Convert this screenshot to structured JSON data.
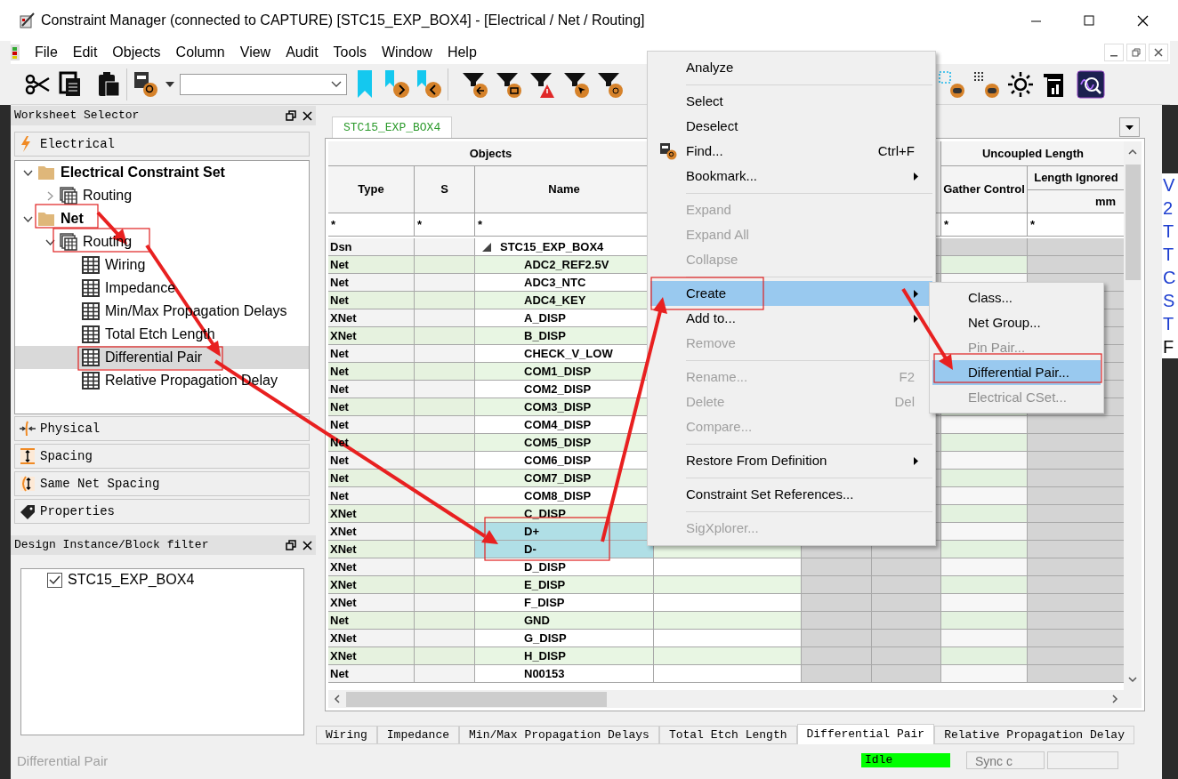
{
  "window": {
    "title": "Constraint Manager (connected to CAPTURE) [STC15_EXP_BOX4] - [Electrical / Net / Routing]"
  },
  "menu_bar": [
    "File",
    "Edit",
    "Objects",
    "Column",
    "View",
    "Audit",
    "Tools",
    "Window",
    "Help"
  ],
  "worksheet_selector": {
    "title": "Worksheet Selector",
    "active_domain": {
      "label": "Electrical",
      "kind": "electrical"
    },
    "tree": [
      {
        "label": "Electrical Constraint Set",
        "kind": "folder",
        "expanded": true,
        "selected": false,
        "children": [
          {
            "label": "Routing",
            "kind": "sheets",
            "expanded": false,
            "selected": false
          }
        ]
      },
      {
        "label": "Net",
        "kind": "folder",
        "expanded": true,
        "selected": false,
        "children": [
          {
            "label": "Routing",
            "kind": "sheets",
            "expanded": true,
            "selected": false,
            "children": [
              {
                "label": "Wiring",
                "kind": "sheet",
                "selected": false
              },
              {
                "label": "Impedance",
                "kind": "sheet",
                "selected": false
              },
              {
                "label": "Min/Max Propagation Delays",
                "kind": "sheet",
                "selected": false
              },
              {
                "label": "Total Etch Length",
                "kind": "sheet",
                "selected": false
              },
              {
                "label": "Differential Pair",
                "kind": "sheet",
                "selected": true
              },
              {
                "label": "Relative Propagation Delay",
                "kind": "sheet",
                "selected": false
              }
            ]
          }
        ]
      }
    ],
    "domains": [
      {
        "label": "Physical",
        "kind": "physical"
      },
      {
        "label": "Spacing",
        "kind": "spacing"
      },
      {
        "label": "Same Net Spacing",
        "kind": "same_net"
      },
      {
        "label": "Properties",
        "kind": "properties"
      }
    ]
  },
  "block_filter": {
    "title": "Design Instance/Block filter",
    "items": [
      {
        "label": "STC15_EXP_BOX4",
        "checked": true
      }
    ]
  },
  "worksheet": {
    "tab": "STC15_EXP_BOX4",
    "objects_header": "Objects",
    "columns": [
      "Type",
      "S",
      "Name"
    ],
    "uncoupled_header": "Uncoupled Length",
    "gather_header": "Gather Control",
    "length_header": "Length Ignored",
    "length_unit": "mm",
    "filters": [
      "*",
      "*",
      "*",
      "*",
      "*"
    ],
    "rows": [
      {
        "type": "Dsn",
        "name": "STC15_EXP_BOX4",
        "kind": "design",
        "selected": false
      },
      {
        "type": "Net",
        "name": "ADC2_REF2.5V",
        "kind": "net",
        "selected": false
      },
      {
        "type": "Net",
        "name": "ADC3_NTC",
        "kind": "net",
        "selected": false
      },
      {
        "type": "Net",
        "name": "ADC4_KEY",
        "kind": "net",
        "selected": false
      },
      {
        "type": "XNet",
        "name": "A_DISP",
        "kind": "net",
        "selected": false
      },
      {
        "type": "XNet",
        "name": "B_DISP",
        "kind": "net",
        "selected": false
      },
      {
        "type": "Net",
        "name": "CHECK_V_LOW",
        "kind": "net",
        "selected": false
      },
      {
        "type": "Net",
        "name": "COM1_DISP",
        "kind": "net",
        "selected": false
      },
      {
        "type": "Net",
        "name": "COM2_DISP",
        "kind": "net",
        "selected": false
      },
      {
        "type": "Net",
        "name": "COM3_DISP",
        "kind": "net",
        "selected": false
      },
      {
        "type": "Net",
        "name": "COM4_DISP",
        "kind": "net",
        "selected": false
      },
      {
        "type": "Net",
        "name": "COM5_DISP",
        "kind": "net",
        "selected": false
      },
      {
        "type": "Net",
        "name": "COM6_DISP",
        "kind": "net",
        "selected": false
      },
      {
        "type": "Net",
        "name": "COM7_DISP",
        "kind": "net",
        "selected": false
      },
      {
        "type": "Net",
        "name": "COM8_DISP",
        "kind": "net",
        "selected": false
      },
      {
        "type": "XNet",
        "name": "C_DISP",
        "kind": "net",
        "selected": false
      },
      {
        "type": "XNet",
        "name": "D+",
        "kind": "net",
        "selected": true
      },
      {
        "type": "XNet",
        "name": "D-",
        "kind": "net",
        "selected": true
      },
      {
        "type": "XNet",
        "name": "D_DISP",
        "kind": "net",
        "selected": false
      },
      {
        "type": "XNet",
        "name": "E_DISP",
        "kind": "net",
        "selected": false
      },
      {
        "type": "XNet",
        "name": "F_DISP",
        "kind": "net",
        "selected": false
      },
      {
        "type": "Net",
        "name": "GND",
        "kind": "net",
        "selected": false
      },
      {
        "type": "XNet",
        "name": "G_DISP",
        "kind": "net",
        "selected": false
      },
      {
        "type": "XNet",
        "name": "H_DISP",
        "kind": "net",
        "selected": false
      },
      {
        "type": "Net",
        "name": "N00153",
        "kind": "net",
        "selected": false
      }
    ]
  },
  "sheet_tabs": [
    {
      "label": "Wiring",
      "selected": false
    },
    {
      "label": "Impedance",
      "selected": false
    },
    {
      "label": "Min/Max Propagation Delays",
      "selected": false
    },
    {
      "label": "Total Etch Length",
      "selected": false
    },
    {
      "label": "Differential Pair",
      "selected": true
    },
    {
      "label": "Relative Propagation Delay",
      "selected": false
    }
  ],
  "status_bar": {
    "text": "Differential Pair",
    "state": "Idle",
    "sync_button": "Sync c"
  },
  "context_menu": [
    {
      "kind": "item",
      "label": "Analyze",
      "disabled": false,
      "selected": false
    },
    {
      "kind": "separator"
    },
    {
      "kind": "item",
      "label": "Select",
      "disabled": false,
      "selected": false
    },
    {
      "kind": "item",
      "label": "Deselect",
      "disabled": false,
      "selected": false
    },
    {
      "kind": "icon_item",
      "label": "Find...",
      "shortcut": "Ctrl+F",
      "disabled": false,
      "selected": false
    },
    {
      "kind": "item",
      "label": "Bookmark...",
      "submenu": true,
      "disabled": false,
      "selected": false
    },
    {
      "kind": "separator"
    },
    {
      "kind": "item",
      "label": "Expand",
      "disabled": true,
      "selected": false
    },
    {
      "kind": "item",
      "label": "Expand All",
      "disabled": true,
      "selected": false
    },
    {
      "kind": "item",
      "label": "Collapse",
      "disabled": true,
      "selected": false
    },
    {
      "kind": "separator"
    },
    {
      "kind": "item",
      "label": "Create",
      "submenu": true,
      "disabled": false,
      "selected": true
    },
    {
      "kind": "item",
      "label": "Add to...",
      "submenu": true,
      "disabled": false,
      "selected": false
    },
    {
      "kind": "item",
      "label": "Remove",
      "disabled": true,
      "selected": false
    },
    {
      "kind": "separator"
    },
    {
      "kind": "item",
      "label": "Rename...",
      "shortcut": "F2",
      "disabled": true,
      "selected": false
    },
    {
      "kind": "item",
      "label": "Delete",
      "shortcut": "Del",
      "disabled": true,
      "selected": false
    },
    {
      "kind": "item",
      "label": "Compare...",
      "disabled": true,
      "selected": false
    },
    {
      "kind": "separator"
    },
    {
      "kind": "item",
      "label": "Restore From Definition",
      "submenu": true,
      "disabled": false,
      "selected": false
    },
    {
      "kind": "separator"
    },
    {
      "kind": "item",
      "label": "Constraint Set References...",
      "disabled": false,
      "selected": false
    },
    {
      "kind": "separator"
    },
    {
      "kind": "item",
      "label": "SigXplorer...",
      "disabled": true,
      "selected": false
    }
  ],
  "create_submenu": [
    {
      "label": "Class...",
      "disabled": false,
      "selected": false
    },
    {
      "label": "Net Group...",
      "disabled": false,
      "selected": false
    },
    {
      "label": "Pin Pair...",
      "disabled": true,
      "selected": false
    },
    {
      "label": "Differential Pair...",
      "disabled": false,
      "selected": true
    },
    {
      "label": "Electrical CSet...",
      "disabled": true,
      "selected": false
    }
  ],
  "background_window_fragments": [
    {
      "text": "V",
      "color": "#1e3fd0"
    },
    {
      "text": "2",
      "color": "#1e3fd0"
    },
    {
      "text": "T",
      "color": "#1e3fd0"
    },
    {
      "text": "T",
      "color": "#1e3fd0"
    },
    {
      "text": "C",
      "color": "#1e3fd0"
    },
    {
      "text": "S",
      "color": "#1e3fd0"
    },
    {
      "text": "T",
      "color": "#1e3fd0"
    },
    {
      "text": "F",
      "color": "#000000"
    }
  ]
}
